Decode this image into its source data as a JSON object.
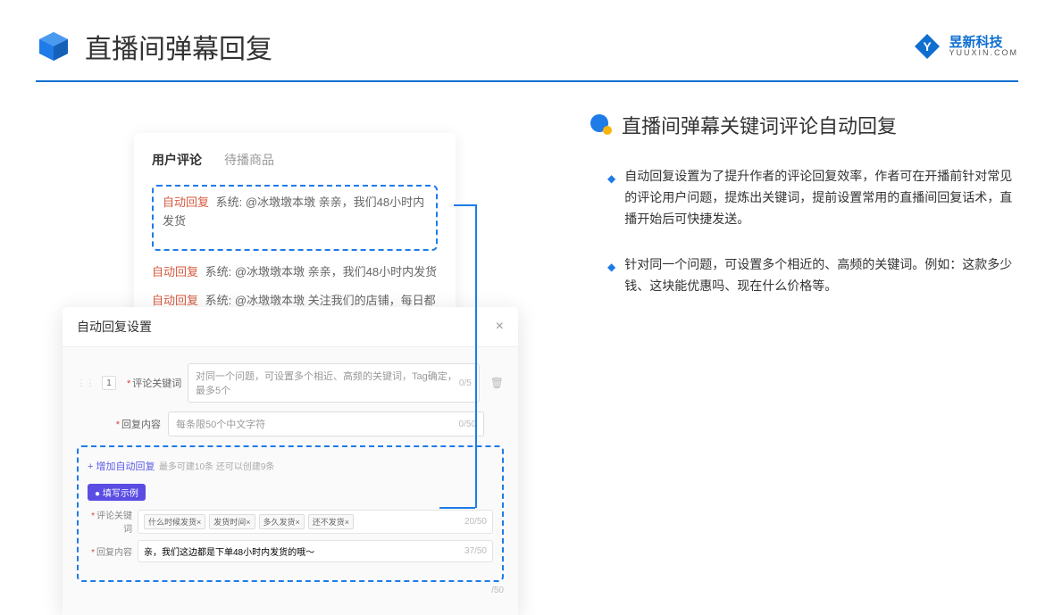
{
  "header": {
    "title": "直播间弹幕回复",
    "logo_main": "昱新科技",
    "logo_sub": "YUUXIN.COM"
  },
  "comments": {
    "tab_active": "用户评论",
    "tab_inactive": "待播商品",
    "rows": [
      {
        "label": "自动回复",
        "text": "系统: @冰墩墩本墩 亲亲，我们48小时内发货"
      },
      {
        "label": "自动回复",
        "text": "系统: @冰墩墩本墩 亲亲，我们48小时内发货"
      },
      {
        "label": "自动回复",
        "text": "系统: @冰墩墩本墩 关注我们的店铺，每日都有热门推荐哟～"
      }
    ]
  },
  "modal": {
    "title": "自动回复设置",
    "index": "1",
    "keyword_label": "评论关键词",
    "keyword_placeholder": "对同一个问题，可设置多个相近、高频的关键词，Tag确定，最多5个",
    "keyword_counter": "0/5",
    "content_label": "回复内容",
    "content_placeholder": "每条限50个中文字符",
    "content_counter": "0/50",
    "add_link": "+ 增加自动回复",
    "add_hint": "最多可建10条 还可以创建9条",
    "example_badge": "● 填写示例",
    "ex_keyword_label": "评论关键词",
    "ex_tags": [
      "什么时候发货×",
      "发货时间×",
      "多久发货×",
      "还不发货×"
    ],
    "ex_kw_counter": "20/50",
    "ex_content_label": "回复内容",
    "ex_content_text": "亲，我们这边都是下单48小时内发货的哦～",
    "ex_content_counter": "37/50",
    "trailing_counter": "/50"
  },
  "right": {
    "title": "直播间弹幕关键词评论自动回复",
    "bullets": [
      "自动回复设置为了提升作者的评论回复效率，作者可在开播前针对常见的评论用户问题，提炼出关键词，提前设置常用的直播间回复话术，直播开始后可快捷发送。",
      "针对同一个问题，可设置多个相近的、高频的关键词。例如：这款多少钱、这块能优惠吗、现在什么价格等。"
    ]
  }
}
